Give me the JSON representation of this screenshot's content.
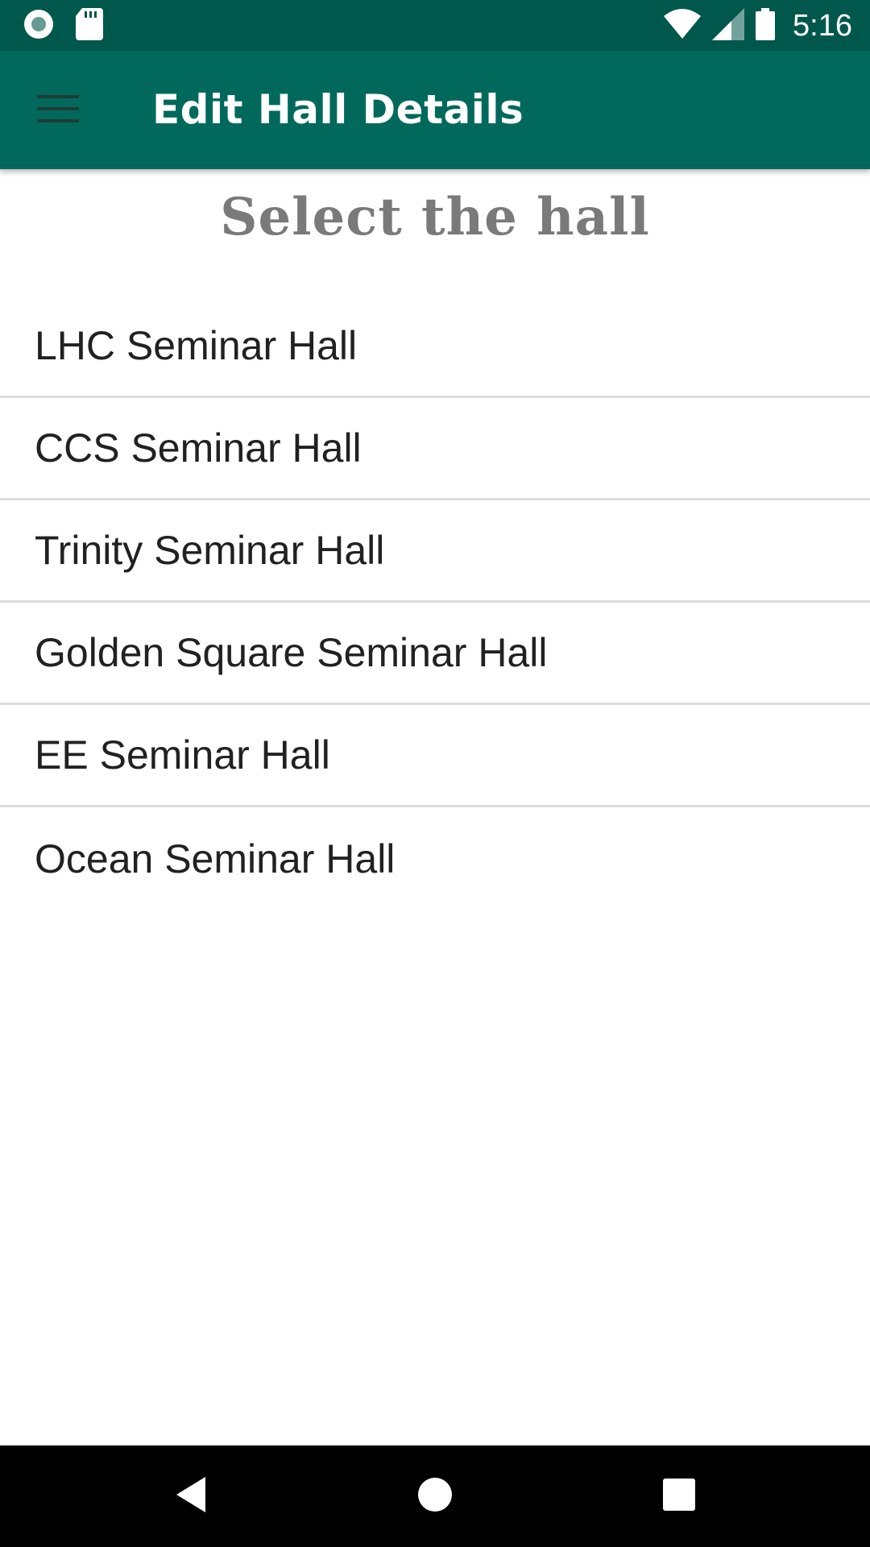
{
  "status_bar": {
    "time": "5:16",
    "left_icons": [
      "record-icon",
      "sd-card-icon"
    ],
    "right_icons": [
      "wifi-icon",
      "signal-icon",
      "battery-icon"
    ],
    "background": "#00574b"
  },
  "app_bar": {
    "title": "Edit Hall Details",
    "menu_icon": "hamburger-menu-icon",
    "background": "#00695c"
  },
  "content": {
    "heading": "Select the hall",
    "halls": [
      {
        "label": "LHC Seminar Hall"
      },
      {
        "label": "CCS Seminar Hall"
      },
      {
        "label": "Trinity Seminar Hall"
      },
      {
        "label": "Golden Square Seminar Hall"
      },
      {
        "label": "EE Seminar Hall"
      },
      {
        "label": "Ocean Seminar Hall"
      }
    ]
  },
  "nav_bar": {
    "buttons": [
      "back-icon",
      "home-icon",
      "recents-icon"
    ]
  }
}
